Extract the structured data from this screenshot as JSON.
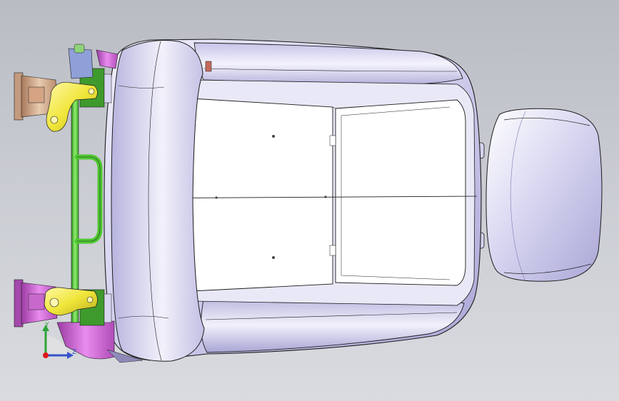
{
  "viewport": {
    "background_top": "#b9bcc3",
    "background_bottom": "#d9dbdf"
  },
  "colors": {
    "seat_shell": "#c8c6ea",
    "seat_shell_light": "#eceaf8",
    "panel": "#ffffff",
    "edge": "#1c1c1c",
    "rail_green": "#58d23a",
    "bracket_yellow": "#f0e63a",
    "bracket_tan": "#d8b89a",
    "foot_magenta": "#d06ad8",
    "axis_x": "#e01818",
    "axis_y": "#2fa33a",
    "axis_z": "#3652c8"
  },
  "triad": {
    "y_label": "Y",
    "z_label": "Z",
    "icon": "coordinate-triad-icon"
  }
}
